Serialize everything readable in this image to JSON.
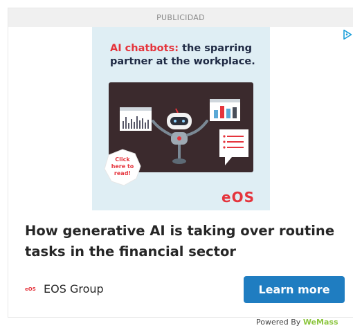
{
  "ad": {
    "label": "PUBLICIDAD",
    "creative": {
      "title_accent": "AI chatbots:",
      "title_rest": " the sparring partner at the workplace.",
      "badge": "Click here to read!",
      "logo": "eOS"
    },
    "headline": "How generative AI is taking over routine tasks in the financial sector",
    "advertiser": {
      "logo_text": "eOS",
      "name": "EOS Group"
    },
    "cta_label": "Learn more",
    "powered_by_prefix": "Powered By ",
    "powered_by_brand": "WeMass"
  },
  "colors": {
    "accent": "#e5343c",
    "cta": "#1f7dc1",
    "creative_bg": "#dfeef4",
    "board": "#3b2a2d"
  },
  "icons": {
    "adchoices": "adchoices-icon"
  }
}
